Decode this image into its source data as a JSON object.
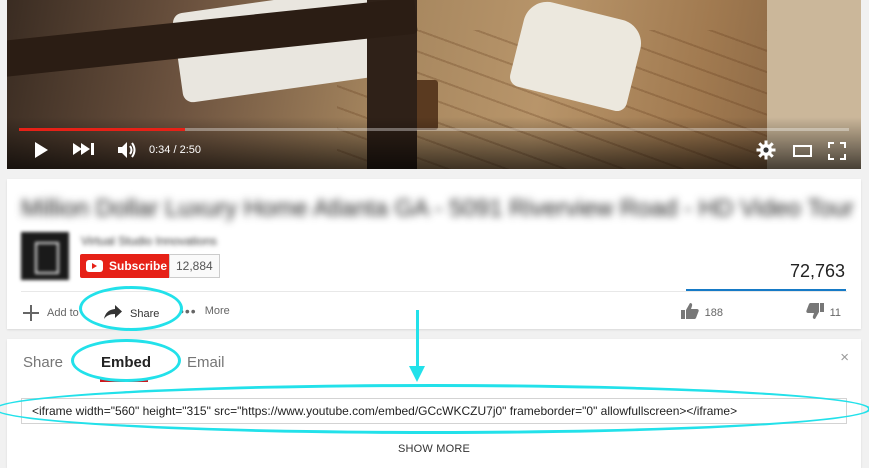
{
  "player": {
    "time_current": "0:34",
    "time_separator": " / ",
    "time_total": "2:50",
    "progress_fraction": 0.2,
    "accent_color": "#e62117",
    "controls": [
      "play-icon",
      "next-icon",
      "volume-icon",
      "settings-gear-icon",
      "theater-mode-icon",
      "fullscreen-icon"
    ]
  },
  "video": {
    "title": "Million Dollar Luxury Home Atlanta GA - 5091 Riverview Road - HD Video Tour",
    "channel_name": "Virtual Studio Innovations",
    "subscribe_label": "Subscribe",
    "subscriber_count": "12,884",
    "view_count": "72,763",
    "actions": {
      "add_to": "Add to",
      "share": "Share",
      "more": "More"
    },
    "likes": "188",
    "dislikes": "11"
  },
  "share_panel": {
    "tabs": [
      {
        "label": "Share",
        "active": false
      },
      {
        "label": "Embed",
        "active": true
      },
      {
        "label": "Email",
        "active": false
      }
    ],
    "close_glyph": "×",
    "embed_code": "<iframe width=\"560\" height=\"315\" src=\"https://www.youtube.com/embed/GCcWKCZU7j0\" frameborder=\"0\" allowfullscreen></iframe>",
    "show_more_label": "SHOW MORE"
  },
  "annotation_color": "#22e1ea"
}
